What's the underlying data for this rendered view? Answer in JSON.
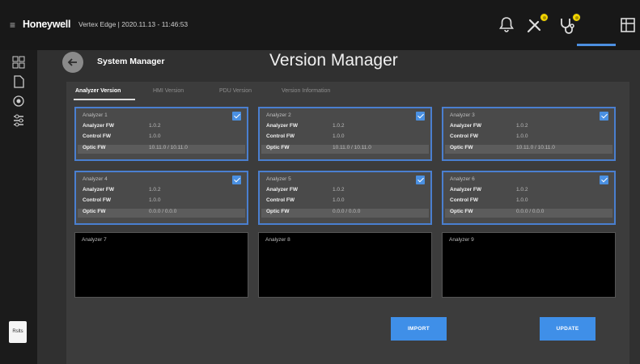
{
  "topbar": {
    "brand": "Honeywell",
    "info": "Vertex Edge | 2020.11.13 - 11:46:53",
    "icons": [
      "menu-icon",
      "bell-icon",
      "tools-icon",
      "stethoscope-icon",
      "panel-icon"
    ],
    "badge_color": "#f1d400",
    "accent": "#4c8fe0"
  },
  "rail": {
    "icons": [
      "grid-icon",
      "document-icon",
      "shield-icon",
      "settings-icon"
    ],
    "doc_label": "Rslts"
  },
  "header": {
    "section": "System Manager",
    "title": "Version Manager"
  },
  "tabs": [
    "Analyzer Version",
    "HMI Version",
    "PDU Version",
    "Version Information"
  ],
  "analyzers": [
    {
      "name": "Analyzer 1",
      "checked": true,
      "rows": [
        {
          "k": "Analyzer FW",
          "v": "1.0.2"
        },
        {
          "k": "Control FW",
          "v": "1.0.0"
        },
        {
          "k": "Optic FW",
          "v": "10.11.0 / 10.11.0"
        }
      ]
    },
    {
      "name": "Analyzer 2",
      "checked": true,
      "rows": [
        {
          "k": "Analyzer FW",
          "v": "1.0.2"
        },
        {
          "k": "Control FW",
          "v": "1.0.0"
        },
        {
          "k": "Optic FW",
          "v": "10.11.0 / 10.11.0"
        }
      ]
    },
    {
      "name": "Analyzer 3",
      "checked": true,
      "rows": [
        {
          "k": "Analyzer FW",
          "v": "1.0.2"
        },
        {
          "k": "Control FW",
          "v": "1.0.0"
        },
        {
          "k": "Optic FW",
          "v": "10.11.0 / 10.11.0"
        }
      ]
    },
    {
      "name": "Analyzer 4",
      "checked": true,
      "rows": [
        {
          "k": "Analyzer FW",
          "v": "1.0.2"
        },
        {
          "k": "Control FW",
          "v": "1.0.0"
        },
        {
          "k": "Optic FW",
          "v": "0.0.0 / 0.0.0"
        }
      ]
    },
    {
      "name": "Analyzer 5",
      "checked": true,
      "rows": [
        {
          "k": "Analyzer FW",
          "v": "1.0.2"
        },
        {
          "k": "Control FW",
          "v": "1.0.0"
        },
        {
          "k": "Optic FW",
          "v": "0.0.0 / 0.0.0"
        }
      ]
    },
    {
      "name": "Analyzer 6",
      "checked": true,
      "rows": [
        {
          "k": "Analyzer FW",
          "v": "1.0.2"
        },
        {
          "k": "Control FW",
          "v": "1.0.0"
        },
        {
          "k": "Optic FW",
          "v": "0.0.0 / 0.0.0"
        }
      ]
    },
    {
      "name": "Analyzer 7",
      "checked": false,
      "rows": []
    },
    {
      "name": "Analyzer 8",
      "checked": false,
      "rows": []
    },
    {
      "name": "Analyzer 9",
      "checked": false,
      "rows": []
    }
  ],
  "buttons": {
    "import": "IMPORT",
    "update": "UPDATE"
  }
}
